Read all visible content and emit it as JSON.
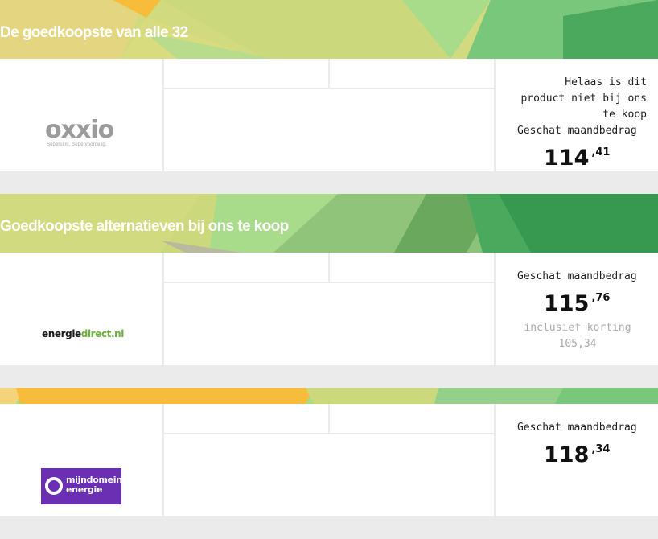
{
  "sections": [
    {
      "title": "De goedkoopste van alle 32",
      "provider": {
        "logo_name": "oxxio",
        "logo_tagline": "Superslim. Supervoordelig."
      },
      "notice": "Helaas is dit product niet bij ons te koop",
      "estimate_label": "Geschat maandbedrag",
      "price_int": "114",
      "price_dec": ",41"
    },
    {
      "title": "Goedkoopste alternatieven bij ons te koop",
      "provider": {
        "logo_name_a": "energie",
        "logo_name_b": "direct.nl"
      },
      "estimate_label": "Geschat maandbedrag",
      "price_int": "115",
      "price_dec": ",76",
      "discount_label": "inclusief korting",
      "discount_value": "105,34"
    },
    {
      "provider": {
        "logo_line1": "mijndomein",
        "logo_line2": "energie"
      },
      "estimate_label": "Geschat maandbedrag",
      "price_int": "118",
      "price_dec": ",34"
    }
  ],
  "colors": {
    "page_bg": "#ebebeb",
    "oxxio_grey": "#9b9b9b",
    "energiedirect_green": "#6ab23a",
    "mijndomein_purple": "#6b2fb3",
    "banner_yellow": "#f7bd3a",
    "banner_green": "#3a9a55"
  }
}
